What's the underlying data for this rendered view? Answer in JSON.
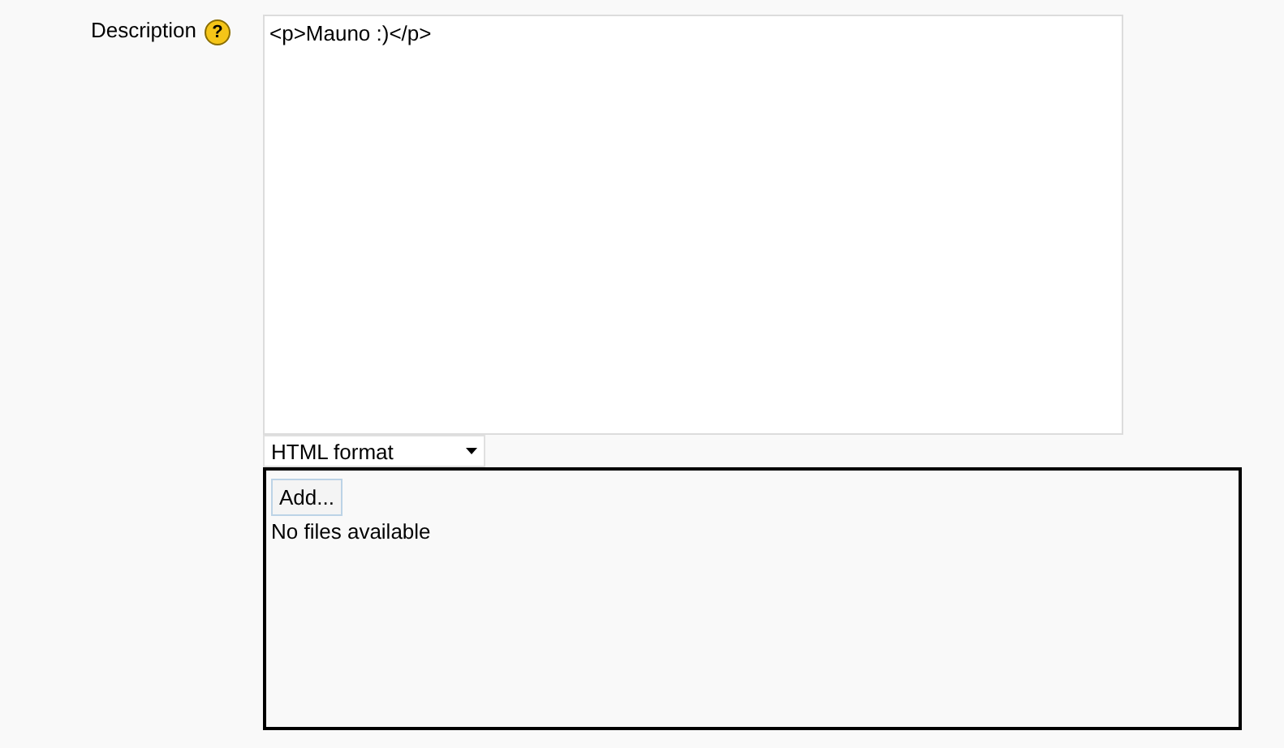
{
  "field": {
    "label": "Description",
    "help": "?",
    "value": "<p>Mauno :)</p>"
  },
  "format_select": {
    "value": "HTML format"
  },
  "file_manager": {
    "add_button": "Add...",
    "empty_message": "No files available"
  }
}
